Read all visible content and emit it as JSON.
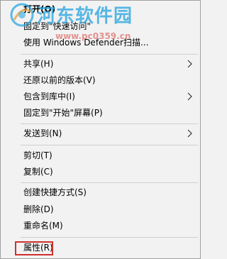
{
  "menu": {
    "items": [
      {
        "label": "打开(O)",
        "submenu": false,
        "bold": true
      },
      {
        "label": "固定到\"快速访问\"",
        "submenu": false
      },
      {
        "label": "使用 Windows Defender扫描...",
        "submenu": false
      },
      {
        "label": "共享(H)",
        "submenu": true
      },
      {
        "label": "还原以前的版本(V)",
        "submenu": false
      },
      {
        "label": "包含到库中(I)",
        "submenu": true
      },
      {
        "label": "固定到\"开始\"屏幕(P)",
        "submenu": false
      },
      {
        "label": "发送到(N)",
        "submenu": true
      },
      {
        "label": "剪切(T)",
        "submenu": false
      },
      {
        "label": "复制(C)",
        "submenu": false
      },
      {
        "label": "创建快捷方式(S)",
        "submenu": false
      },
      {
        "label": "删除(D)",
        "submenu": false
      },
      {
        "label": "重命名(M)",
        "submenu": false
      },
      {
        "label": "属性(R)",
        "submenu": false,
        "highlighted": true
      }
    ]
  },
  "watermark": {
    "text": "河东软件园",
    "url": "www.pc0359.cn"
  },
  "colors": {
    "menu_background": "#f2f2f2",
    "separator": "#cfcfcf",
    "highlight_border": "#d0312d",
    "watermark_blue": "#2aa6e0"
  }
}
